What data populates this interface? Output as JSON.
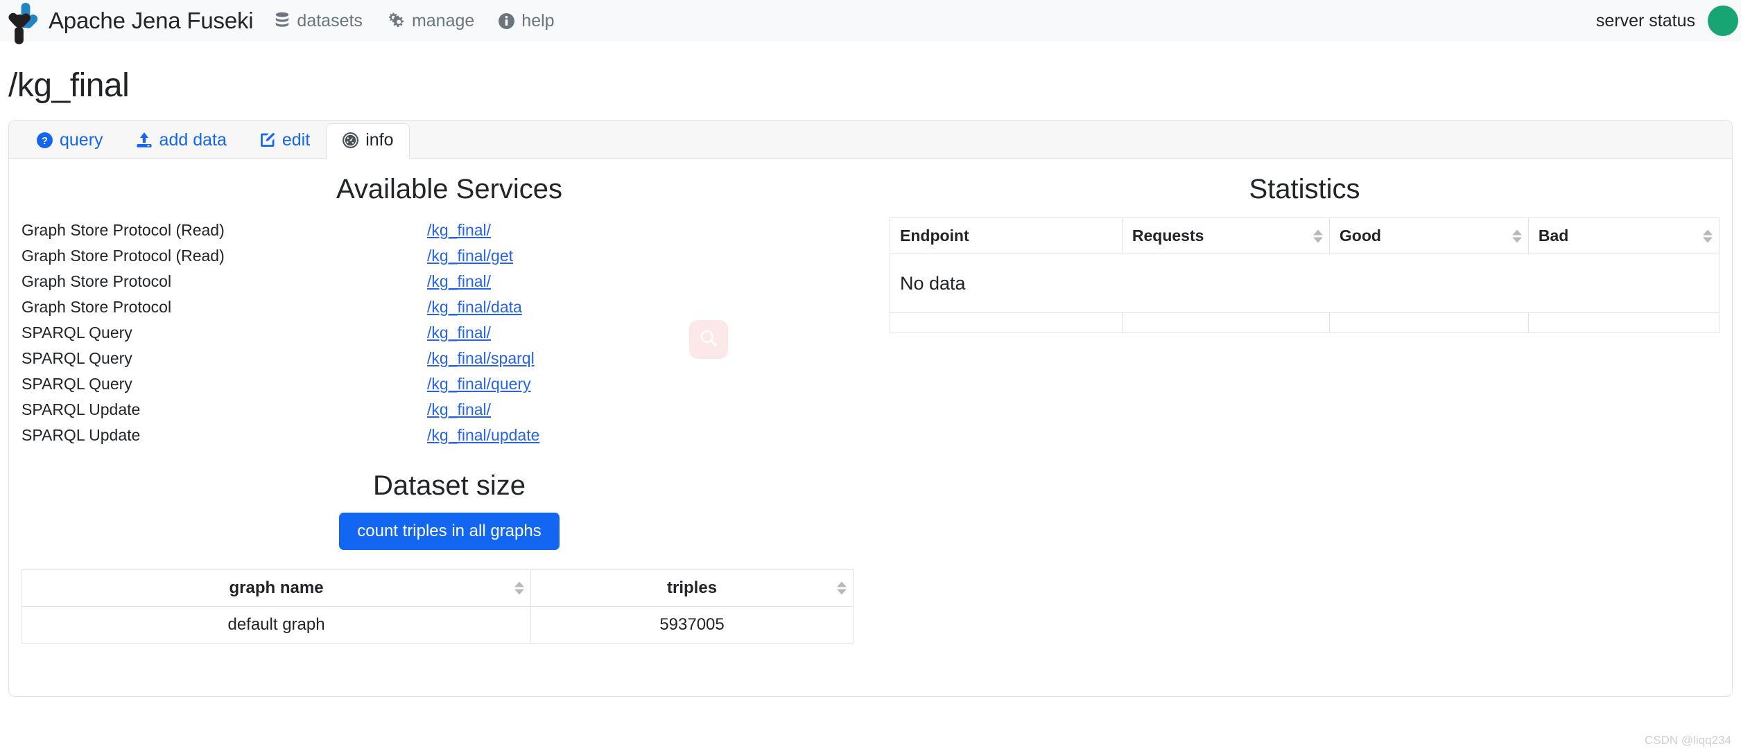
{
  "navbar": {
    "brand": "Apache Jena Fuseki",
    "links": [
      {
        "label": "datasets",
        "icon": "database-icon"
      },
      {
        "label": "manage",
        "icon": "gears-icon"
      },
      {
        "label": "help",
        "icon": "info-circle-icon"
      }
    ],
    "server_status_label": "server status",
    "server_status_color": "#17a673"
  },
  "page": {
    "title": "/kg_final"
  },
  "tabs": [
    {
      "label": "query",
      "icon": "question-circle-icon",
      "active": false
    },
    {
      "label": "add data",
      "icon": "upload-icon",
      "active": false
    },
    {
      "label": "edit",
      "icon": "pencil-square-icon",
      "active": false
    },
    {
      "label": "info",
      "icon": "dashboard-icon",
      "active": true
    }
  ],
  "services": {
    "title": "Available Services",
    "rows": [
      {
        "name": "Graph Store Protocol (Read)",
        "endpoint": "/kg_final/"
      },
      {
        "name": "Graph Store Protocol (Read)",
        "endpoint": "/kg_final/get"
      },
      {
        "name": "Graph Store Protocol",
        "endpoint": "/kg_final/"
      },
      {
        "name": "Graph Store Protocol",
        "endpoint": "/kg_final/data"
      },
      {
        "name": "SPARQL Query",
        "endpoint": "/kg_final/"
      },
      {
        "name": "SPARQL Query",
        "endpoint": "/kg_final/sparql"
      },
      {
        "name": "SPARQL Query",
        "endpoint": "/kg_final/query"
      },
      {
        "name": "SPARQL Update",
        "endpoint": "/kg_final/"
      },
      {
        "name": "SPARQL Update",
        "endpoint": "/kg_final/update"
      }
    ]
  },
  "statistics": {
    "title": "Statistics",
    "columns": [
      {
        "label": "Endpoint",
        "sortable": false
      },
      {
        "label": "Requests",
        "sortable": true
      },
      {
        "label": "Good",
        "sortable": true
      },
      {
        "label": "Bad",
        "sortable": true
      }
    ],
    "empty_message": "No data"
  },
  "dataset_size": {
    "title": "Dataset size",
    "count_button": "count triples in all graphs",
    "columns": [
      {
        "label": "graph name",
        "sortable": true
      },
      {
        "label": "triples",
        "sortable": true
      }
    ],
    "rows": [
      {
        "graph_name": "default graph",
        "triples": "5937005"
      }
    ]
  },
  "watermarks": {
    "search_overlay_icon": "magnifier-icon",
    "credit": "CSDN @liqq234"
  },
  "colors": {
    "link": "#2563eb",
    "primary_button": "#1266f1",
    "tab_link": "#1266f1",
    "nav_muted": "#6c757d",
    "status_green": "#17a673"
  }
}
